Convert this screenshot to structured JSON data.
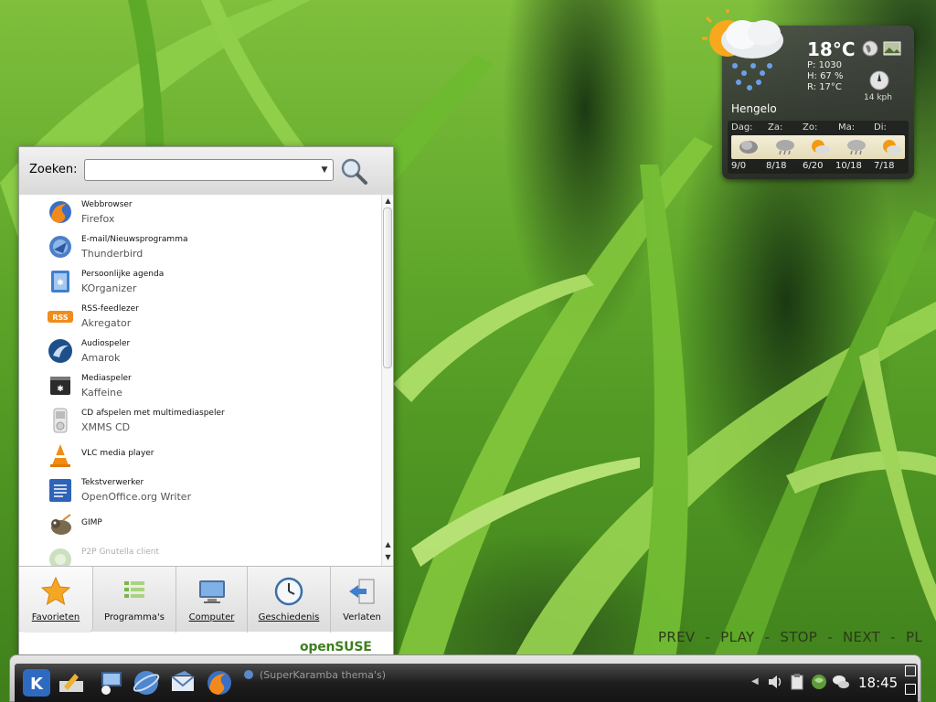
{
  "weather": {
    "temperature": "18°C",
    "pressure": "P: 1030",
    "humidity": "H: 67 %",
    "real_feel": "R: 17°C",
    "wind": "14 kph",
    "city": "Hengelo",
    "forecast": [
      {
        "day": "Dag:",
        "temps": "9/0",
        "icon": "cloudy-icon"
      },
      {
        "day": "Za:",
        "temps": "8/18",
        "icon": "showers-icon"
      },
      {
        "day": "Zo:",
        "temps": "6/20",
        "icon": "partly-sunny-icon"
      },
      {
        "day": "Ma:",
        "temps": "10/18",
        "icon": "showers-icon"
      },
      {
        "day": "Di:",
        "temps": "7/18",
        "icon": "partly-sunny-icon"
      }
    ]
  },
  "media_controls": [
    "PREV",
    "-",
    "PLAY",
    "-",
    "STOP",
    "-",
    "NEXT",
    "-",
    "PL"
  ],
  "menu": {
    "search_label": "Zoeken:",
    "search_value": "",
    "items": [
      {
        "category": "Webbrowser",
        "name": "Firefox",
        "icon": "firefox-icon"
      },
      {
        "category": "E-mail/Nieuwsprogramma",
        "name": "Thunderbird",
        "icon": "thunderbird-icon"
      },
      {
        "category": "Persoonlijke agenda",
        "name": "KOrganizer",
        "icon": "korganizer-icon"
      },
      {
        "category": "RSS-feedlezer",
        "name": "Akregator",
        "icon": "akregator-icon"
      },
      {
        "category": "Audiospeler",
        "name": "Amarok",
        "icon": "amarok-icon"
      },
      {
        "category": "Mediaspeler",
        "name": "Kaffeine",
        "icon": "kaffeine-icon"
      },
      {
        "category": "CD afspelen met multimediaspeler",
        "name": "XMMS CD",
        "icon": "xmms-icon"
      },
      {
        "category": "",
        "name": "VLC media player",
        "icon": "vlc-icon"
      },
      {
        "category": "Tekstverwerker",
        "name": "OpenOffice.org Writer",
        "icon": "writer-icon"
      },
      {
        "category": "",
        "name": "GIMP",
        "icon": "gimp-icon"
      },
      {
        "category": "P2P Gnutella client",
        "name": "",
        "icon": "gnutella-icon"
      }
    ],
    "tabs": [
      {
        "label": "Favorieten",
        "icon": "star-icon"
      },
      {
        "label": "Programma's",
        "icon": "programs-icon"
      },
      {
        "label": "Computer",
        "icon": "computer-icon"
      },
      {
        "label": "Geschiedenis",
        "icon": "clock-icon"
      },
      {
        "label": "Verlaten",
        "icon": "logout-icon"
      }
    ],
    "brand": "openSUSE"
  },
  "taskbar": {
    "task_title": "(SuperKaramba thema's)",
    "clock": "18:45"
  }
}
